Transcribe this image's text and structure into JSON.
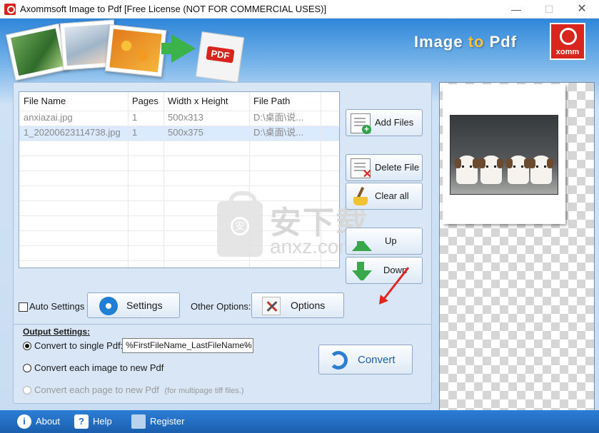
{
  "window": {
    "title": "Axommsoft Image to Pdf [Free License (NOT FOR COMMERCIAL USES)]",
    "minimize": "—",
    "maximize": "☐",
    "close": "✕"
  },
  "banner": {
    "title_part1": "Image",
    "title_part2": "to",
    "title_part3": "Pdf",
    "pdf_badge": "PDF",
    "brand": "xomm"
  },
  "file_table": {
    "columns": [
      "File Name",
      "Pages",
      "Width x Height",
      "File Path"
    ],
    "rows": [
      [
        "anxiazai.jpg",
        "1",
        "500x313",
        "D:\\桌面\\说..."
      ],
      [
        "1_20200623114738.jpg",
        "1",
        "500x375",
        "D:\\桌面\\说..."
      ]
    ]
  },
  "watermark": {
    "line1": "安下载",
    "line2": "anxz.com",
    "glyph": "安"
  },
  "side_buttons": {
    "add_files": "Add Files",
    "delete_file": "Delete File",
    "clear_all": "Clear all",
    "up": "Up",
    "down": "Down"
  },
  "options_row": {
    "auto_settings": "Auto Settings",
    "settings": "Settings",
    "other_options": "Other Options:",
    "options": "Options"
  },
  "output": {
    "title": "Output Settings:",
    "single_pdf": "Convert to single Pdf:",
    "name_pattern": "%FirstFileName_LastFileName%",
    "each_image": "Convert each image to new Pdf",
    "each_page": "Convert each page to new Pdf",
    "each_page_hint": "(for multipage tiff files.)",
    "convert": "Convert",
    "selected_mode": "single_pdf"
  },
  "bottom_bar": {
    "about": "About",
    "help": "Help",
    "register": "Register"
  },
  "colors": {
    "accent": "#2e7fd4",
    "brand_red": "#d8261e",
    "panel_bg": "#d8e6f5",
    "bottom_bar": "#1f6fc8"
  },
  "icons": {
    "add_files": "add-document-icon",
    "delete_file": "delete-document-icon",
    "clear_all": "broom-icon",
    "up": "arrow-up-icon",
    "down": "arrow-down-icon",
    "settings": "gear-icon",
    "options": "tools-icon",
    "convert": "refresh-icon",
    "about": "info-icon",
    "help": "help-book-icon",
    "register": "cart-icon"
  }
}
